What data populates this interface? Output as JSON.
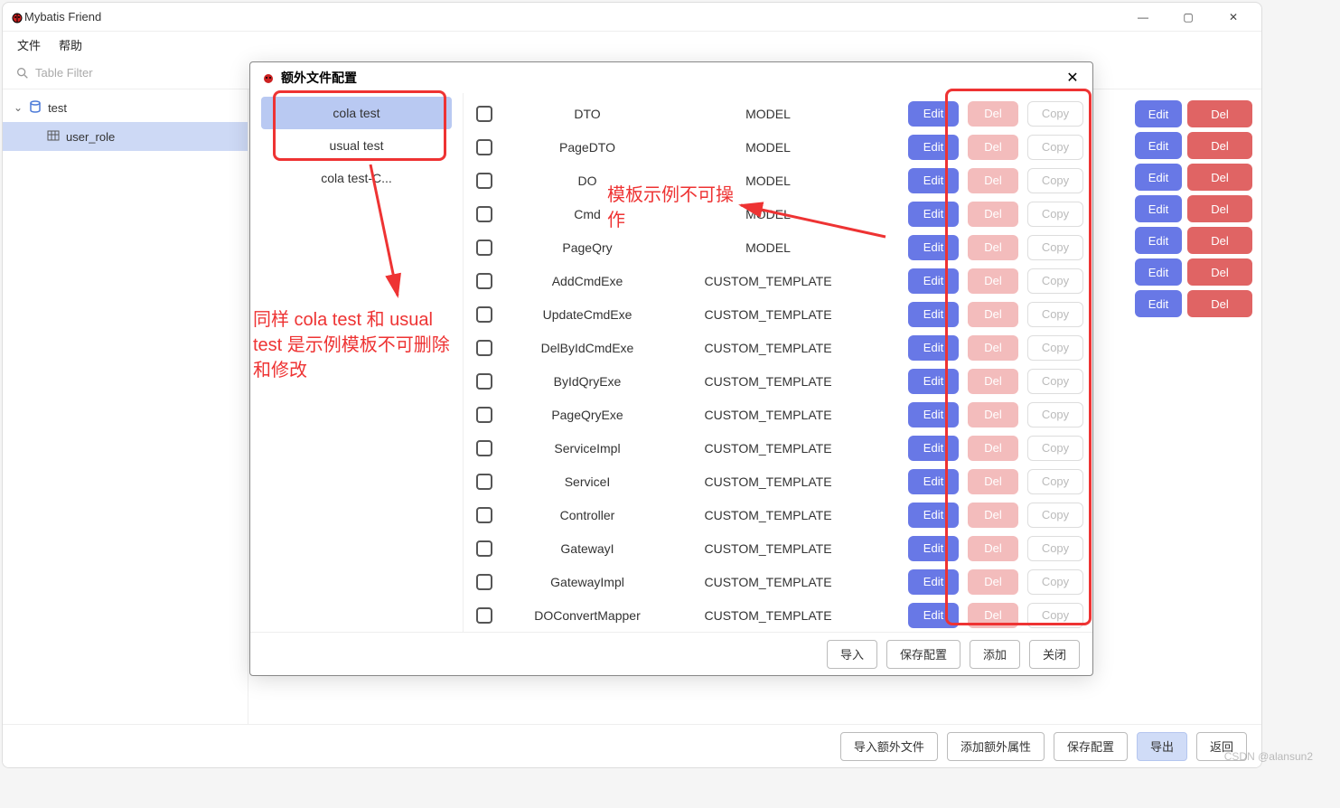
{
  "window": {
    "title": "Mybatis Friend",
    "minimize": "—",
    "maximize": "▢",
    "close": "✕"
  },
  "menubar": {
    "file": "文件",
    "help": "帮助"
  },
  "filter": {
    "placeholder": "Table Filter"
  },
  "tree": {
    "root": "test",
    "child": "user_role"
  },
  "bg_buttons": {
    "edit": "Edit",
    "del": "Del"
  },
  "bg_rows_count": 7,
  "modal": {
    "title": "额外文件配置",
    "close": "✕",
    "templates": [
      {
        "label": "cola test",
        "selected": true
      },
      {
        "label": "usual test",
        "selected": false
      },
      {
        "label": "cola test-C...",
        "selected": false
      }
    ],
    "buttons": {
      "edit": "Edit",
      "del": "Del",
      "copy": "Copy"
    },
    "rows": [
      {
        "name": "DTO",
        "type": "MODEL"
      },
      {
        "name": "PageDTO",
        "type": "MODEL"
      },
      {
        "name": "DO",
        "type": "MODEL"
      },
      {
        "name": "Cmd",
        "type": "MODEL"
      },
      {
        "name": "PageQry",
        "type": "MODEL"
      },
      {
        "name": "AddCmdExe",
        "type": "CUSTOM_TEMPLATE"
      },
      {
        "name": "UpdateCmdExe",
        "type": "CUSTOM_TEMPLATE"
      },
      {
        "name": "DelByIdCmdExe",
        "type": "CUSTOM_TEMPLATE"
      },
      {
        "name": "ByIdQryExe",
        "type": "CUSTOM_TEMPLATE"
      },
      {
        "name": "PageQryExe",
        "type": "CUSTOM_TEMPLATE"
      },
      {
        "name": "ServiceImpl",
        "type": "CUSTOM_TEMPLATE"
      },
      {
        "name": "ServiceI",
        "type": "CUSTOM_TEMPLATE"
      },
      {
        "name": "Controller",
        "type": "CUSTOM_TEMPLATE"
      },
      {
        "name": "GatewayI",
        "type": "CUSTOM_TEMPLATE"
      },
      {
        "name": "GatewayImpl",
        "type": "CUSTOM_TEMPLATE"
      },
      {
        "name": "DOConvertMapper",
        "type": "CUSTOM_TEMPLATE"
      }
    ],
    "footer": {
      "import": "导入",
      "save": "保存配置",
      "add": "添加",
      "close": "关闭"
    }
  },
  "bottom": {
    "import_extra": "导入额外文件",
    "add_extra_attr": "添加额外属性",
    "save_config": "保存配置",
    "export": "导出",
    "back": "返回"
  },
  "annotations": {
    "text1": "模板示例不可操作",
    "text2": "同样 cola test 和 usual test 是示例模板不可删除和修改"
  },
  "watermark": "CSDN @alansun2"
}
